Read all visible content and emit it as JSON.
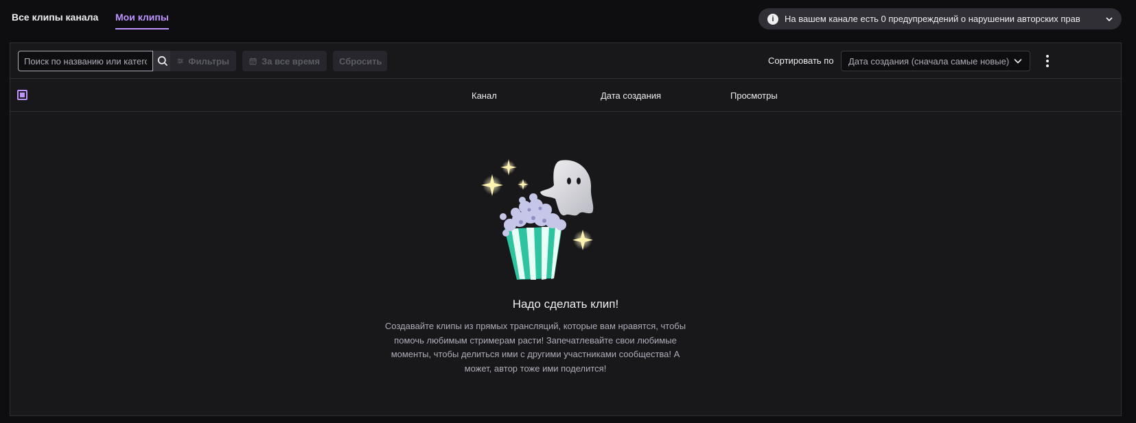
{
  "tabs": {
    "all_clips": "Все клипы канала",
    "my_clips": "Мои клипы"
  },
  "notice": {
    "text": "На вашем канале есть 0 предупреждений о нарушении авторских прав"
  },
  "toolbar": {
    "search_placeholder": "Поиск по названию или категории",
    "filters_label": "Фильтры",
    "time_label": "За все время",
    "reset_label": "Сбросить",
    "sort_label": "Сортировать по",
    "sort_value": "Дата создания (сначала самые новые)"
  },
  "table": {
    "columns": [
      "Канал",
      "Дата создания",
      "Просмотры"
    ]
  },
  "empty_state": {
    "title": "Надо сделать клип!",
    "description": "Создавайте клипы из прямых трансляций, которые вам нравятся, чтобы помочь любимым стримерам расти! Запечатлевайте свои любимые моменты, чтобы делиться ими с другими участниками сообщества! А может, автор тоже ими поделится!"
  },
  "colors": {
    "background": "#0e0e10",
    "panel": "#18181b",
    "accent": "#bf94ff",
    "border": "#2f2f35"
  },
  "icons": [
    "info-icon",
    "chevron-down-icon",
    "search-icon",
    "sliders-icon",
    "calendar-icon",
    "more-vertical-icon",
    "ghost-icon",
    "popcorn-icon",
    "sparkle-icon"
  ]
}
